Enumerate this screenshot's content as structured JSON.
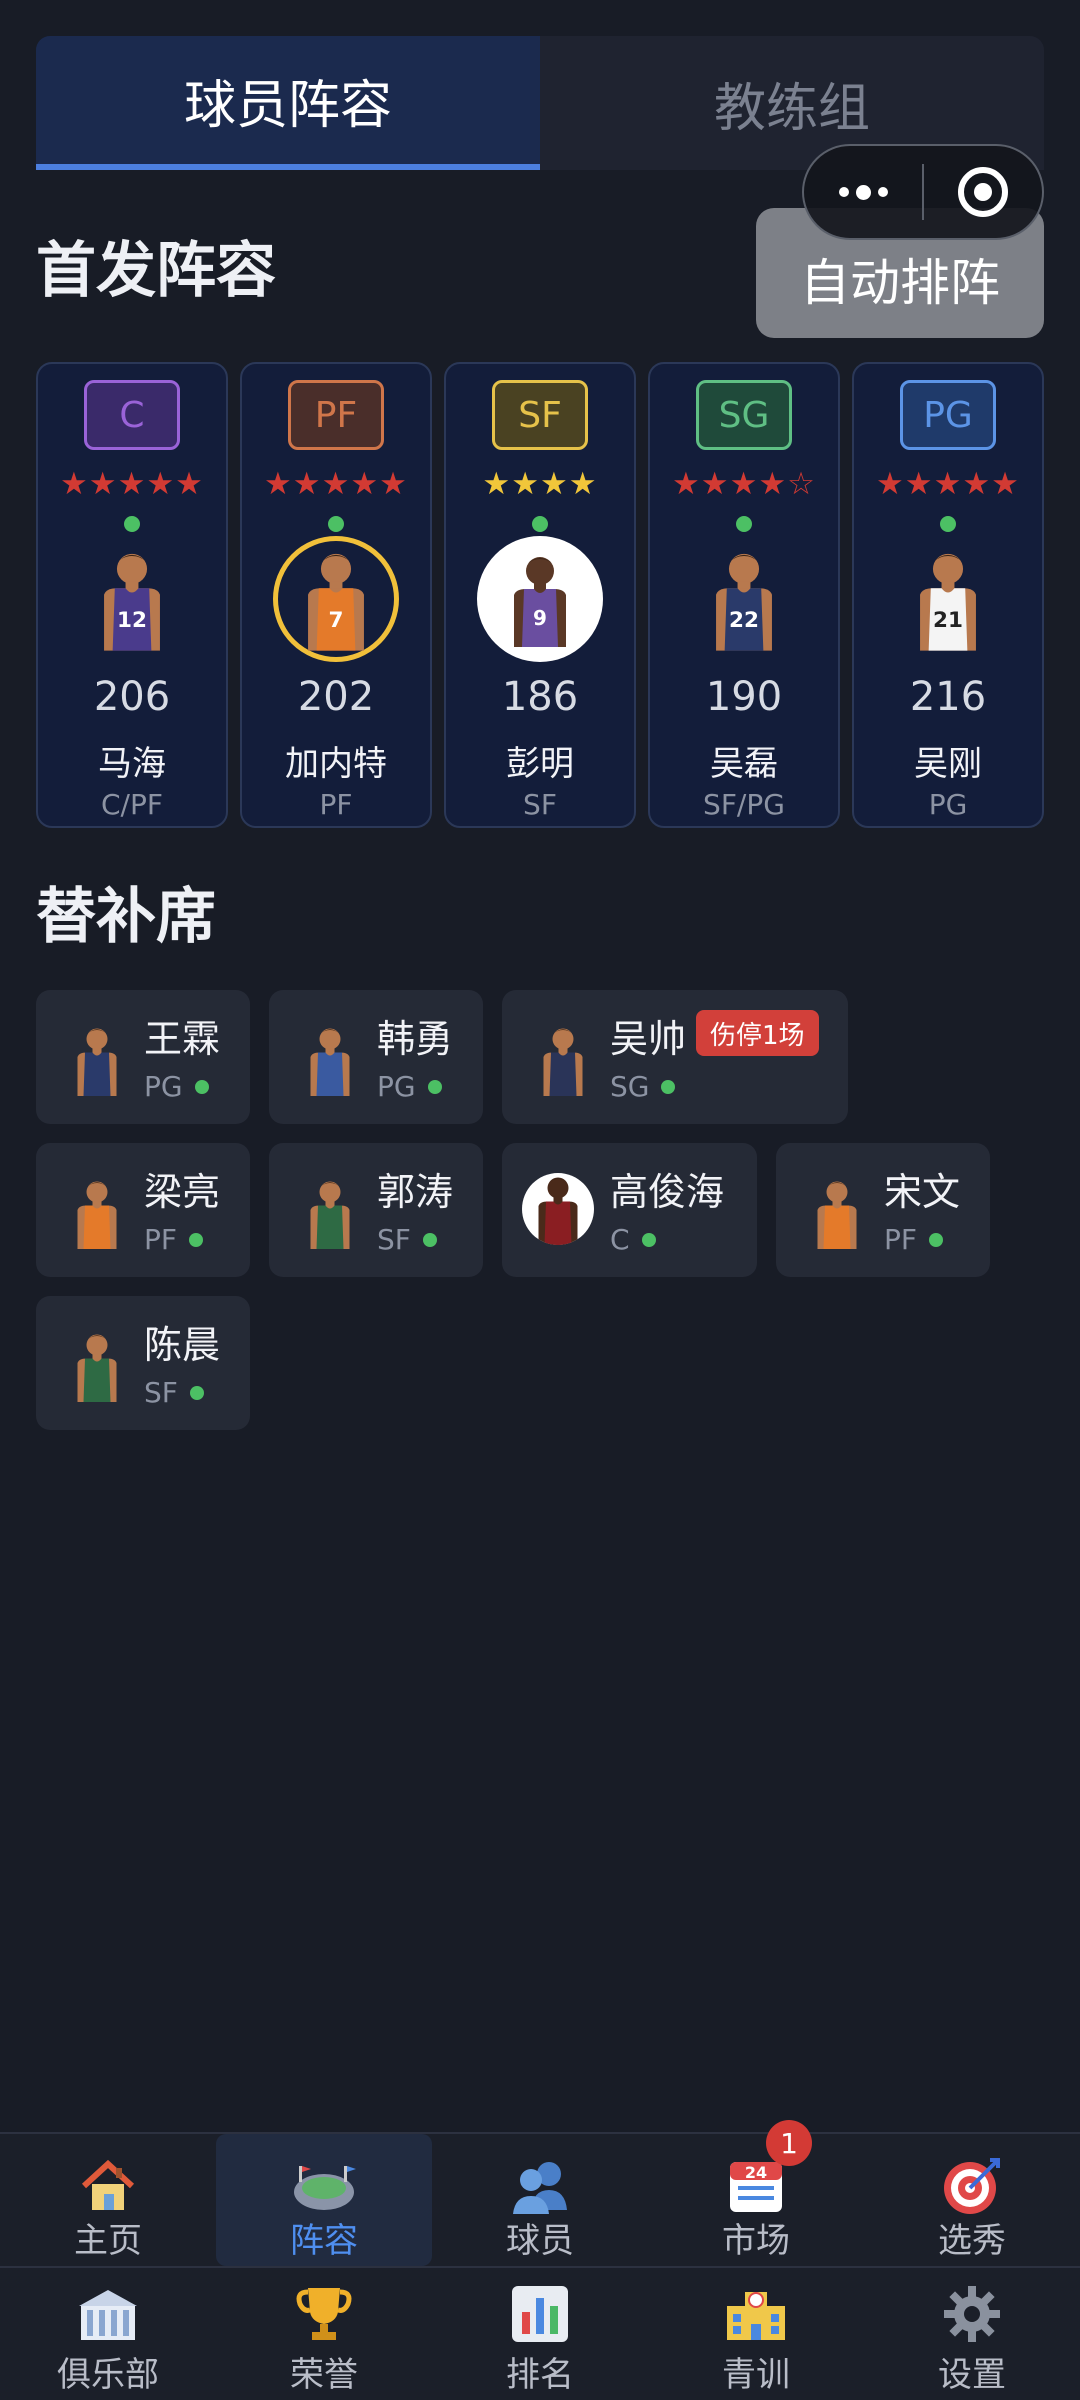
{
  "tabs": [
    {
      "label": "球员阵容",
      "active": true
    },
    {
      "label": "教练组",
      "active": false
    }
  ],
  "starting_title": "首发阵容",
  "auto_button": "自动排阵",
  "starters": [
    {
      "badge": "C",
      "badge_color": "#9a63d8",
      "badge_bg": "#3a2a6a",
      "stars": "★★★★★",
      "star_color": "#d23a33",
      "jersey": "#4a3b8c",
      "jersey_num": "12",
      "overall": "206",
      "name": "马海",
      "position": "C/PF"
    },
    {
      "badge": "PF",
      "badge_color": "#d0764a",
      "badge_bg": "#4a2e2a",
      "stars": "★★★★★",
      "star_color": "#d23a33",
      "jersey": "#e47a2a",
      "jersey_num": "7",
      "overall": "202",
      "name": "加内特",
      "position": "PF"
    },
    {
      "badge": "SF",
      "badge_color": "#e6c24a",
      "badge_bg": "#4a4222",
      "stars": "★★★★",
      "star_color": "#f1c63a",
      "jersey": "#6a4ea0",
      "jersey_num": "9",
      "overall": "186",
      "name": "彭明",
      "position": "SF"
    },
    {
      "badge": "SG",
      "badge_color": "#5fbf84",
      "badge_bg": "#1f4a3a",
      "stars": "★★★★☆",
      "star_color": "#d23a33",
      "jersey": "#2a3a6a",
      "jersey_num": "22",
      "overall": "190",
      "name": "吴磊",
      "position": "SF/PG"
    },
    {
      "badge": "PG",
      "badge_color": "#5c94e6",
      "badge_bg": "#1f3a6a",
      "stars": "★★★★★",
      "star_color": "#d23a33",
      "jersey": "#f4f4f4",
      "jersey_num": "21",
      "overall": "216",
      "name": "吴刚",
      "position": "PG"
    }
  ],
  "bench_title": "替补席",
  "bench": [
    {
      "name": "王霖",
      "position": "PG",
      "jersey": "#2a3a6a",
      "injury": ""
    },
    {
      "name": "韩勇",
      "position": "PG",
      "jersey": "#3a5aa0",
      "injury": ""
    },
    {
      "name": "吴帅",
      "position": "SG",
      "jersey": "#2a3458",
      "injury": "伤停1场"
    },
    {
      "name": "梁亮",
      "position": "PF",
      "jersey": "#e47a2a",
      "injury": ""
    },
    {
      "name": "郭涛",
      "position": "SF",
      "jersey": "#2e6a44",
      "injury": ""
    },
    {
      "name": "高俊海",
      "position": "C",
      "jersey": "#8a1e22",
      "injury": ""
    },
    {
      "name": "宋文",
      "position": "PF",
      "jersey": "#e47a2a",
      "injury": ""
    },
    {
      "name": "陈晨",
      "position": "SF",
      "jersey": "#2e6a44",
      "injury": ""
    }
  ],
  "nav_primary": [
    {
      "label": "主页",
      "icon": "house-icon",
      "active": false
    },
    {
      "label": "阵容",
      "icon": "stadium-icon",
      "active": true
    },
    {
      "label": "球员",
      "icon": "people-icon",
      "active": false
    },
    {
      "label": "市场",
      "icon": "calendar-icon",
      "active": false,
      "badge": "1"
    },
    {
      "label": "选秀",
      "icon": "target-icon",
      "active": false
    }
  ],
  "nav_secondary": [
    {
      "label": "俱乐部",
      "icon": "building-icon",
      "active": false
    },
    {
      "label": "荣誉",
      "icon": "trophy-icon",
      "active": false
    },
    {
      "label": "排名",
      "icon": "bar-chart-icon",
      "active": false
    },
    {
      "label": "青训",
      "icon": "school-icon",
      "active": false
    },
    {
      "label": "设置",
      "icon": "gear-icon",
      "active": false
    }
  ]
}
